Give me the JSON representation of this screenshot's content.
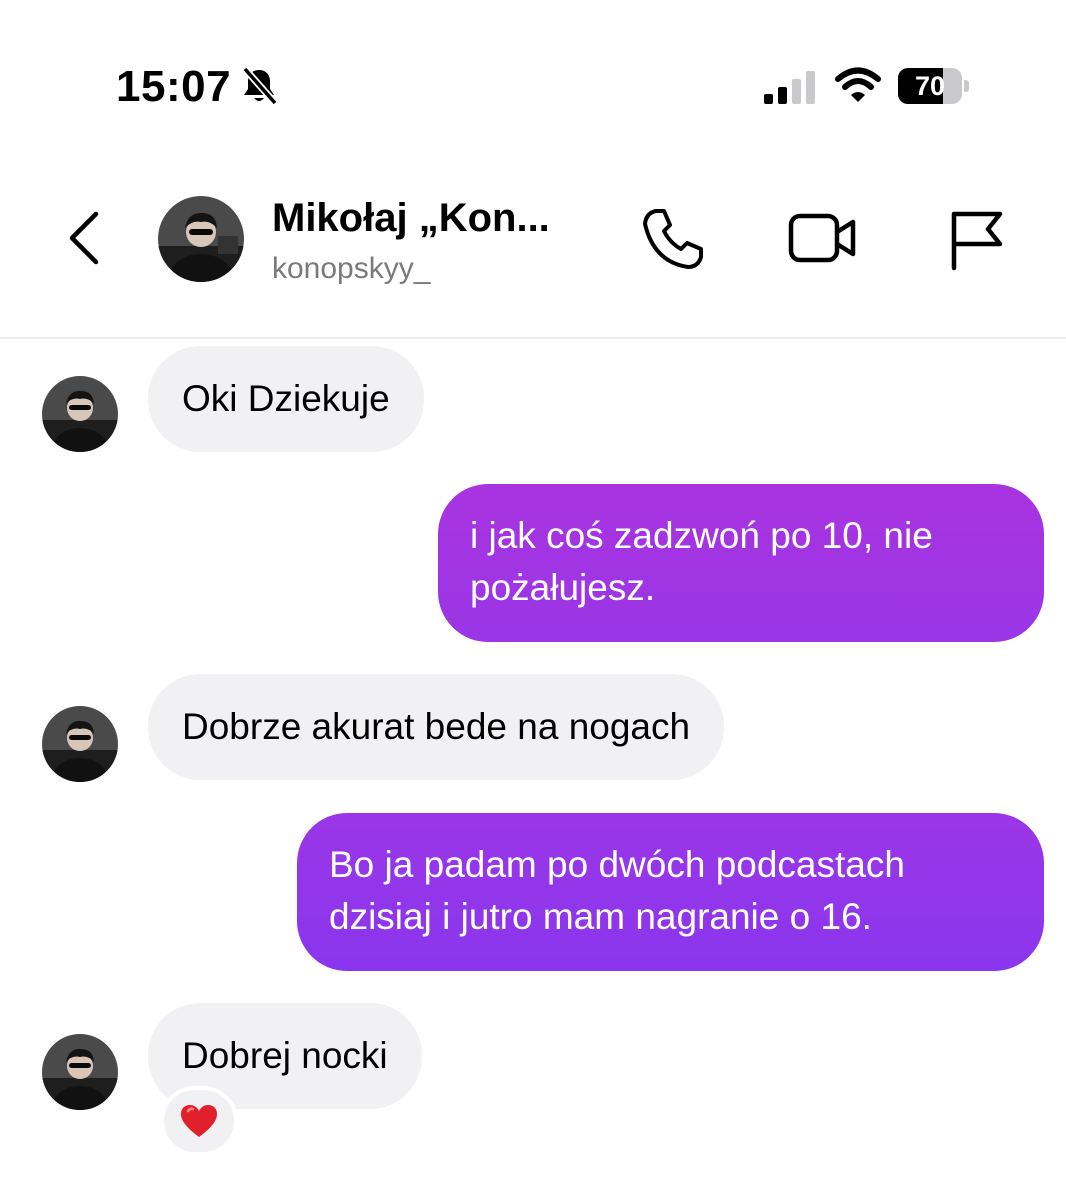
{
  "status_bar": {
    "time": "15:07",
    "battery_level": 70,
    "battery_text": "70",
    "silent_icon": "bell-slash-icon",
    "signal_icon": "cellular-signal-icon",
    "wifi_icon": "wifi-icon"
  },
  "header": {
    "name": "Mikołaj „Kon...",
    "handle": "konopskyy_",
    "back_icon": "chevron-left-icon",
    "call_icon": "phone-icon",
    "video_icon": "video-camera-icon",
    "report_icon": "flag-icon"
  },
  "messages": [
    {
      "direction": "incoming",
      "text": "Oki Dziekuje"
    },
    {
      "direction": "outgoing",
      "lines": [
        "i jak coś zadzwoń po 10, nie",
        "pożałujesz."
      ]
    },
    {
      "direction": "incoming",
      "text": "Dobrze akurat bede na nogach"
    },
    {
      "direction": "outgoing",
      "lines": [
        "Bo ja padam po dwóch podcastach",
        "dzisiaj i jutro mam nagranie o 16."
      ]
    },
    {
      "direction": "incoming",
      "text": "Dobrej nocki",
      "reaction": "heart-icon"
    }
  ],
  "colors": {
    "outgoing_gradient_start": "#a933e0",
    "outgoing_gradient_end": "#8a36ee",
    "incoming_bubble": "#f1f1f3",
    "handle_text": "#7a7a7a",
    "heart": "#e0202a"
  }
}
